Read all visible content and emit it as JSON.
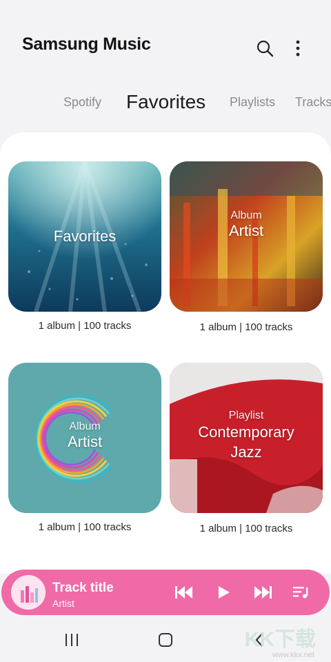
{
  "app": {
    "title": "Samsung Music"
  },
  "tabs": [
    {
      "label": "Spotify",
      "active": false
    },
    {
      "label": "Favorites",
      "active": true
    },
    {
      "label": "Playlists",
      "active": false
    },
    {
      "label": "Tracks",
      "active": false
    }
  ],
  "cards": [
    {
      "sub": "",
      "main": "Favorites",
      "meta": "1 album | 100 tracks"
    },
    {
      "sub": "Album",
      "main": "Artist",
      "meta": "1 album | 100 tracks"
    },
    {
      "sub": "Album",
      "main": "Artist",
      "meta": "1 album | 100 tracks"
    },
    {
      "sub": "Playlist",
      "main": "Contemporary\nJazz",
      "meta": "1 album | 100 tracks"
    }
  ],
  "player": {
    "title": "Track title",
    "artist": "Artist"
  },
  "icons": {
    "search": "search-icon",
    "more": "more-vert-icon",
    "prev": "skip-previous-icon",
    "play": "play-icon",
    "next": "skip-next-icon",
    "queue": "queue-music-icon",
    "recents": "recents-icon",
    "home": "home-icon",
    "back": "back-icon"
  },
  "watermark": {
    "text": "KK下载",
    "url": "www.kkx.net"
  },
  "colors": {
    "accent": "#f06aa7",
    "background": "#f3f3f6"
  }
}
